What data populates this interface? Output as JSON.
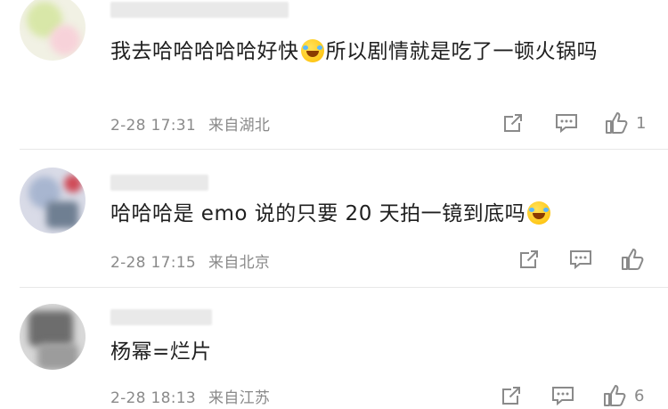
{
  "comments": [
    {
      "text_a": "我去哈哈哈哈哈好快",
      "text_b": "所以剧情就是吃了一顿火锅吗",
      "time": "2-28 17:31",
      "location": "来自湖北",
      "likes": "1"
    },
    {
      "text_a": "哈哈哈是 emo 说的只要 20 天拍一镜到底吗",
      "time": "2-28 17:15",
      "location": "来自北京",
      "likes": ""
    },
    {
      "text_a": "杨幂=烂片",
      "time": "2-28 18:13",
      "location": "来自江苏",
      "likes": "6"
    }
  ],
  "icons": {
    "forward": "share-icon",
    "comment": "comment-icon",
    "like": "thumb-up-icon",
    "emoji": "laughing-tears-emoji"
  },
  "colors": {
    "text": "#1f1f1f",
    "meta": "#8a8a8a",
    "divider": "#e8e8e8"
  }
}
